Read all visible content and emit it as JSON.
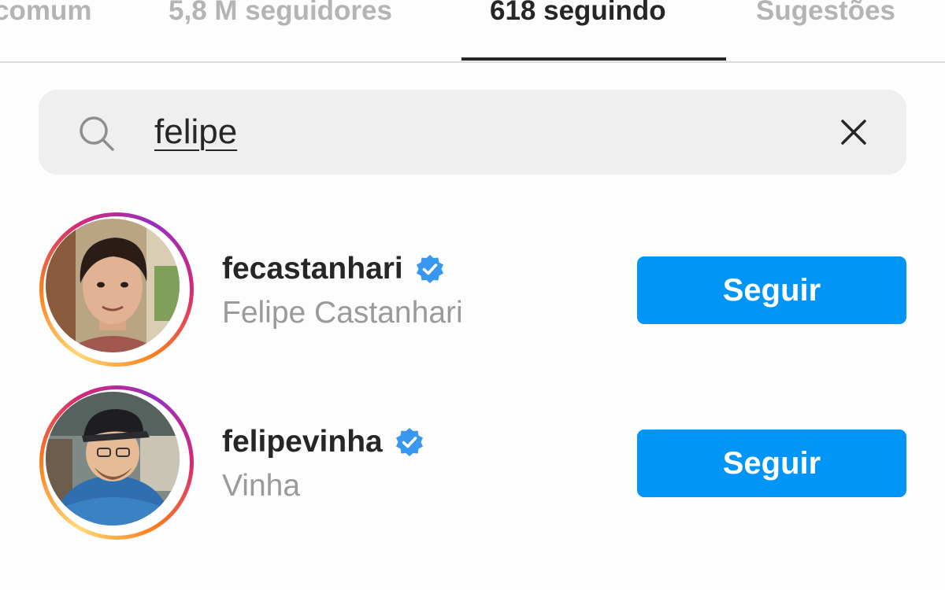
{
  "tabs": [
    {
      "label": "comum",
      "active": false
    },
    {
      "label": "5,8 M seguidores",
      "active": false
    },
    {
      "label": "618 seguindo",
      "active": true
    },
    {
      "label": "Sugestões",
      "active": false
    }
  ],
  "search": {
    "value": "felipe",
    "icon": "search-icon",
    "clear_icon": "close-icon"
  },
  "results": [
    {
      "username": "fecastanhari",
      "full_name": "Felipe Castanhari",
      "verified": true,
      "button_label": "Seguir"
    },
    {
      "username": "felipevinha",
      "full_name": "Vinha",
      "verified": true,
      "button_label": "Seguir"
    }
  ],
  "colors": {
    "accent": "#0095f6",
    "verified": "#3897f0",
    "text_primary": "#262626",
    "text_secondary": "#9a9a9a",
    "tab_inactive": "#b4b4b4",
    "search_bg": "#efefef"
  }
}
